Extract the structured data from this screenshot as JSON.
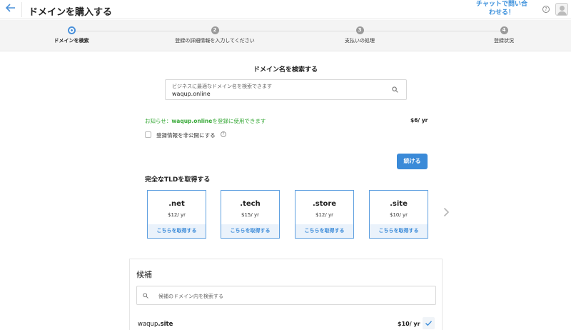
{
  "header": {
    "title": "ドメインを購入する",
    "chat_line1": "チャットで問い合",
    "chat_line2": "わせる！",
    "help_label": "?"
  },
  "steps": [
    {
      "num": "1",
      "label": "ドメインを検索",
      "active": true
    },
    {
      "num": "2",
      "label": "登録の詳細情報を入力してください",
      "active": false
    },
    {
      "num": "3",
      "label": "支払いの処理",
      "active": false
    },
    {
      "num": "4",
      "label": "登録状況",
      "active": false
    }
  ],
  "search": {
    "title": "ドメイン名を検索する",
    "placeholder": "ビジネスに最適なドメイン名を検索できます",
    "value": "waqup.online"
  },
  "notice": {
    "prefix": "お知らせ：",
    "domain": "waqup.online",
    "suffix": "を登録に使用できます",
    "price": "$6/ yr"
  },
  "privacy": {
    "label": "登録情報を非公開にする",
    "help": "?"
  },
  "continue_label": "続ける",
  "tld_section": {
    "title": "完全なTLDを取得する",
    "get_label": "こちらを取得する",
    "cards": [
      {
        "name": ".net",
        "price": "$12/ yr"
      },
      {
        "name": ".tech",
        "price": "$15/ yr"
      },
      {
        "name": ".store",
        "price": "$12/ yr"
      },
      {
        "name": ".site",
        "price": "$10/ yr"
      }
    ]
  },
  "candidates": {
    "title": "候補",
    "search_placeholder": "候補のドメイン内を検索する",
    "rows": [
      {
        "name_base": "waqup",
        "name_tld": ".site",
        "price": "$10/ yr"
      }
    ]
  },
  "colors": {
    "accent": "#3a8ad8",
    "success": "#3aaa3a",
    "card_border": "#5fa0e0"
  }
}
